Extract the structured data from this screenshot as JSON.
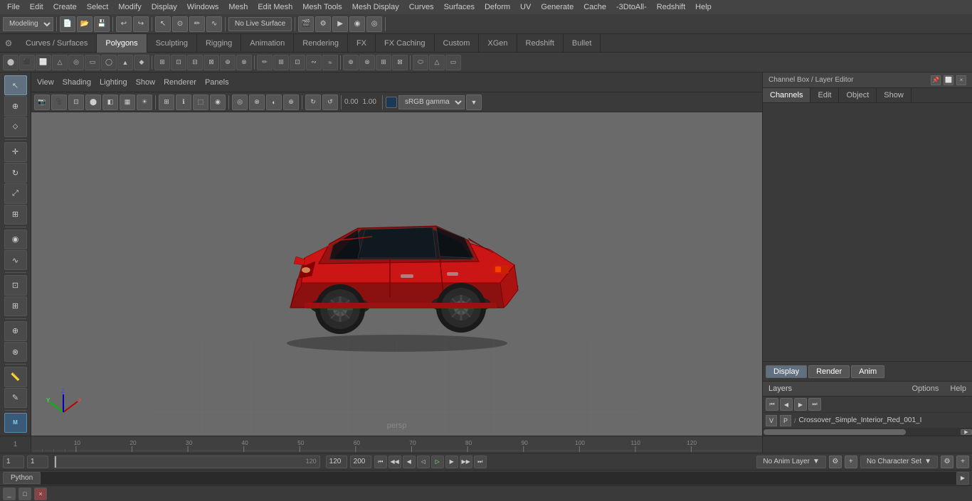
{
  "menu": {
    "items": [
      "File",
      "Edit",
      "Create",
      "Select",
      "Modify",
      "Display",
      "Windows",
      "Mesh",
      "Edit Mesh",
      "Mesh Tools",
      "Mesh Display",
      "Curves",
      "Surfaces",
      "Deform",
      "UV",
      "Generate",
      "Cache",
      "-3DtoAll-",
      "Redshift",
      "Help"
    ]
  },
  "toolbar1": {
    "workspace_label": "Modeling",
    "live_surface_label": "No Live Surface"
  },
  "tabs": {
    "items": [
      "Curves / Surfaces",
      "Polygons",
      "Sculpting",
      "Rigging",
      "Animation",
      "Rendering",
      "FX",
      "FX Caching",
      "Custom",
      "XGen",
      "Redshift",
      "Bullet"
    ],
    "active": "Polygons"
  },
  "viewport": {
    "menu": [
      "View",
      "Shading",
      "Lighting",
      "Show",
      "Renderer",
      "Panels"
    ],
    "label": "persp",
    "gamma_label": "sRGB gamma",
    "translate": {
      "x": "0.00",
      "y": "1.00"
    }
  },
  "right_panel": {
    "title": "Channel Box / Layer Editor",
    "tabs": [
      "Channels",
      "Edit",
      "Object",
      "Show"
    ],
    "display_tabs": [
      "Display",
      "Render",
      "Anim"
    ],
    "active_display": "Display",
    "layers_label": "Layers",
    "options_label": "Options",
    "help_label": "Help",
    "layer_nav_icons": [
      "◀◀",
      "◀",
      "▶",
      "▶▶"
    ],
    "layer": {
      "v_label": "V",
      "p_label": "P",
      "name": "Crossover_Simple_Interior_Red_001_I"
    }
  },
  "timeline": {
    "start": "1",
    "end": "120",
    "current": "1",
    "ticks": [
      "1",
      "10",
      "20",
      "30",
      "40",
      "50",
      "60",
      "70",
      "80",
      "90",
      "100",
      "110",
      "120"
    ]
  },
  "status_bar": {
    "frame1": "1",
    "frame2": "1",
    "playback_end": "120",
    "anim_end": "200",
    "anim_layer": "No Anim Layer",
    "char_set": "No Character Set"
  },
  "transport": {
    "current_frame": "1",
    "buttons": [
      "⏮",
      "⏭",
      "◀",
      "▶◀",
      "▶",
      "▶▶",
      "⏭"
    ]
  },
  "python": {
    "label": "Python"
  },
  "script_tab": "Python",
  "window": {
    "title": "",
    "controls": [
      "_",
      "□",
      "×"
    ]
  },
  "icons": {
    "settings": "⚙",
    "chevron_down": "▼",
    "arrow_left": "◀",
    "arrow_right": "▶",
    "close": "×",
    "minimize": "_",
    "restore": "□"
  }
}
